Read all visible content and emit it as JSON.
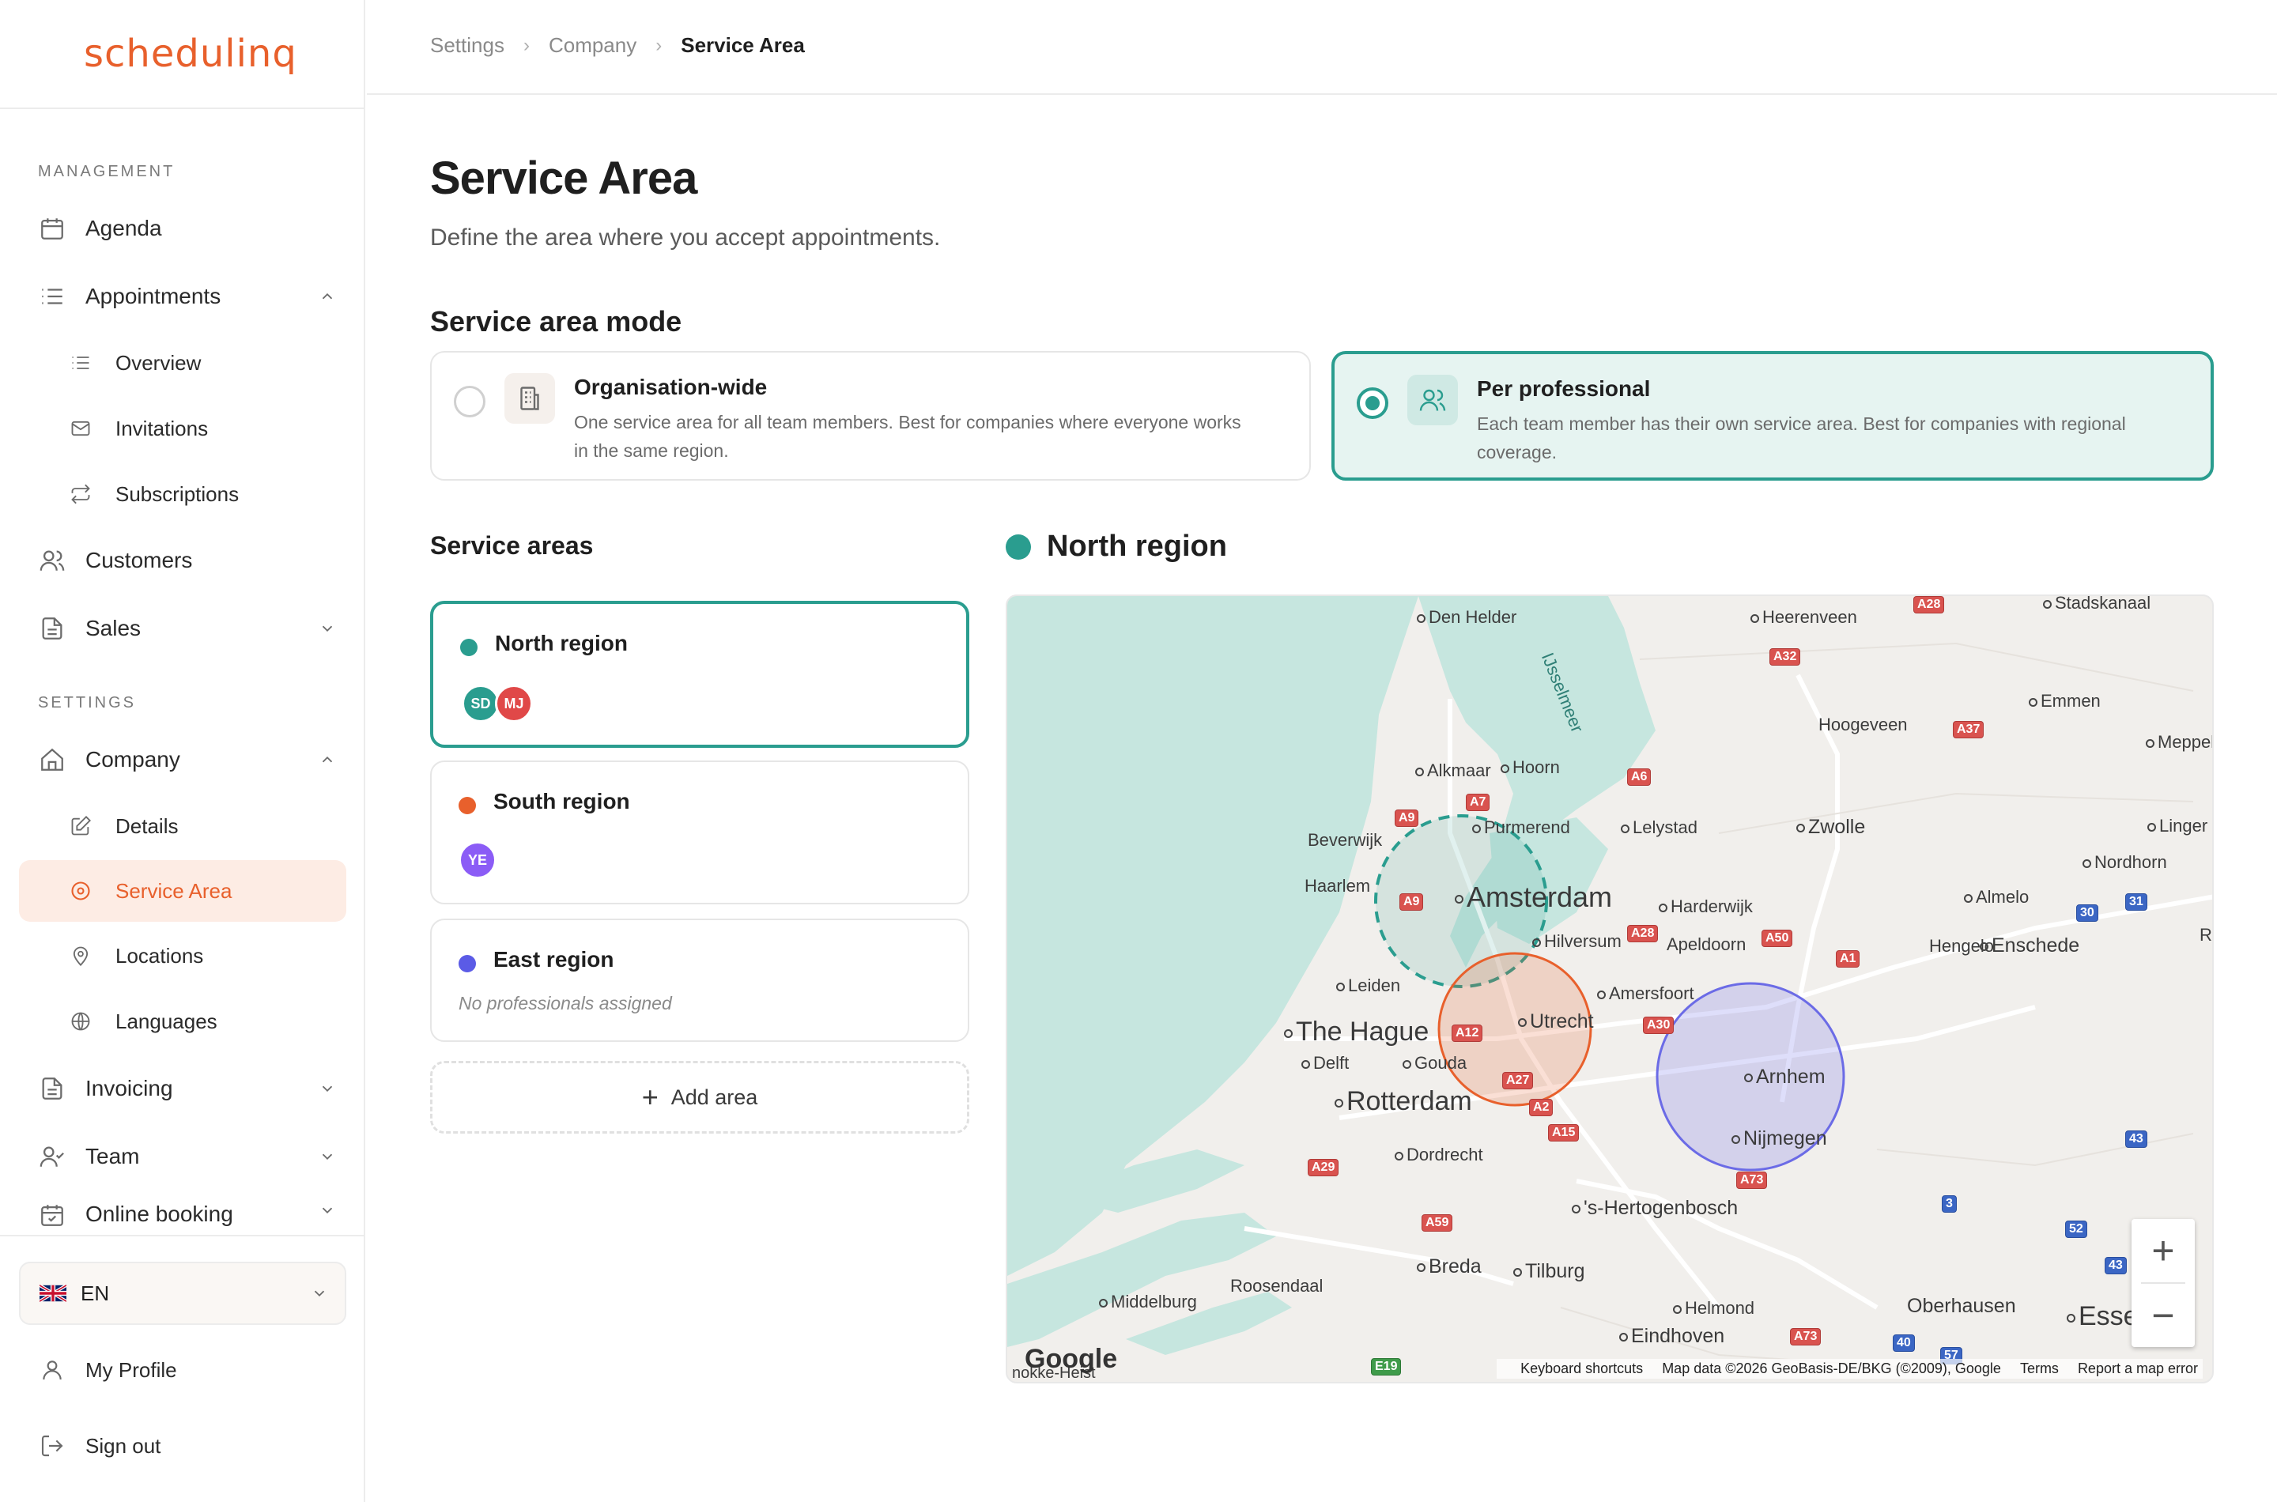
{
  "brand": {
    "name": "schedulinq"
  },
  "sidebar": {
    "management_label": "MANAGEMENT",
    "settings_label": "SETTINGS",
    "items": {
      "agenda": "Agenda",
      "appointments": "Appointments",
      "overview": "Overview",
      "invitations": "Invitations",
      "subscriptions": "Subscriptions",
      "customers": "Customers",
      "sales": "Sales",
      "company": "Company",
      "details": "Details",
      "service_area": "Service Area",
      "locations": "Locations",
      "languages": "Languages",
      "invoicing": "Invoicing",
      "team": "Team",
      "online_booking": "Online booking"
    },
    "language": "EN",
    "my_profile": "My Profile",
    "sign_out": "Sign out"
  },
  "breadcrumb": [
    "Settings",
    "Company",
    "Service Area"
  ],
  "page": {
    "title": "Service Area",
    "subtitle": "Define the area where you accept appointments."
  },
  "mode": {
    "title": "Service area mode",
    "options": [
      {
        "name": "Organisation-wide",
        "description": "One service area for all team members. Best for companies where everyone works in the same region.",
        "selected": false
      },
      {
        "name": "Per professional",
        "description": "Each team member has their own service area. Best for companies with regional coverage.",
        "selected": true
      }
    ]
  },
  "areas": {
    "title": "Service areas",
    "list": [
      {
        "name": "North region",
        "color": "#2a9d8f",
        "members": [
          {
            "initials": "SD",
            "color": "#2a9d8f"
          },
          {
            "initials": "MJ",
            "color": "#e04848"
          }
        ],
        "selected": true
      },
      {
        "name": "South region",
        "color": "#e8602c",
        "members": [
          {
            "initials": "YE",
            "color": "#8b5cf6"
          }
        ],
        "selected": false
      },
      {
        "name": "East region",
        "color": "#5b5be6",
        "members": [],
        "empty_text": "No professionals assigned",
        "selected": false
      }
    ],
    "add_label": "Add area"
  },
  "map": {
    "selected_region": "North region",
    "cities": {
      "den_helder": "Den Helder",
      "heerenveen": "Heerenveen",
      "stadskanaal": "Stadskanaal",
      "emmen": "Emmen",
      "hoogeveen": "Hoogeveen",
      "meppel": "Meppel",
      "alkmaar": "Alkmaar",
      "hoorn": "Hoorn",
      "purmerend": "Purmerend",
      "lelystad": "Lelystad",
      "zwolle": "Zwolle",
      "lingen": "Linger",
      "beverwijk": "Beverwijk",
      "nordhorn": "Nordhorn",
      "haarlem": "Haarlem",
      "amsterdam": "Amsterdam",
      "harderwijk": "Harderwijk",
      "almelo": "Almelo",
      "hilversum": "Hilversum",
      "apeldoorn": "Apeldoorn",
      "hengelo": "Hengelo",
      "enschede": "Enschede",
      "leiden": "Leiden",
      "amersfoort": "Amersfoort",
      "the_hague": "The Hague",
      "utrecht": "Utrecht",
      "delft": "Delft",
      "gouda": "Gouda",
      "arnhem": "Arnhem",
      "rotterdam": "Rotterdam",
      "nijmegen": "Nijmegen",
      "dordrecht": "Dordrecht",
      "s_hertogenbosch": "'s-Hertogenbosch",
      "breda": "Breda",
      "tilburg": "Tilburg",
      "roosendaal": "Roosendaal",
      "middelburg": "Middelburg",
      "helmond": "Helmond",
      "oberhausen": "Oberhausen",
      "essen": "Esse",
      "eindhoven": "Eindhoven",
      "ijsselmeer": "IJsselmeer",
      "knokke": "nokke-Heist",
      "r_edge": "R"
    },
    "roads": {
      "a28n": "A28",
      "a32": "A32",
      "a37": "A37",
      "a6": "A6",
      "a7": "A7",
      "a9a": "A9",
      "a9b": "A9",
      "a28": "A28",
      "a50": "A50",
      "a1": "A1",
      "a30": "A30",
      "a12": "A12",
      "a27": "A27",
      "a2": "A2",
      "a15": "A15",
      "a29": "A29",
      "a59": "A59",
      "a73": "A73",
      "a73b": "A73",
      "n30": "30",
      "n31": "31",
      "n43": "43",
      "n3": "3",
      "n52": "52",
      "n43b": "43",
      "n40": "40",
      "n57": "57",
      "e19": "E19"
    },
    "google": "Google",
    "footer": {
      "shortcuts": "Keyboard shortcuts",
      "data": "Map data ©2026 GeoBasis-DE/BKG (©2009), Google",
      "terms": "Terms",
      "report": "Report a map error"
    },
    "zoom_in": "+",
    "zoom_out": "−"
  }
}
